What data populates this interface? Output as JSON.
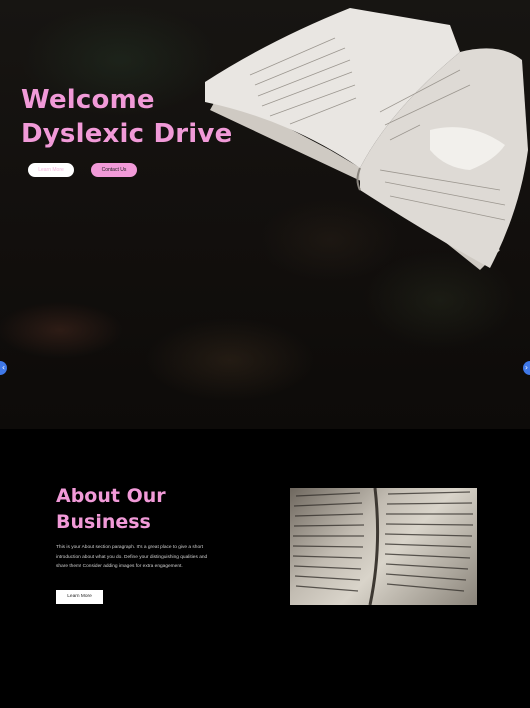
{
  "hero": {
    "title_line1": "Welcome",
    "title_line2": "Dyslexic Drive",
    "learn_more_label": "Learn More",
    "contact_label": "Contact Us",
    "prev_icon": "chevron-left-icon",
    "next_icon": "chevron-right-icon"
  },
  "about": {
    "title_line1": "About Our",
    "title_line2": "Business",
    "paragraph": "This is your About section paragraph. It's a great place to give a short introduction about what you do. Define your distinguishing qualities and share them! Consider adding images for extra engagement.",
    "button_label": "Learn More"
  },
  "colors": {
    "accent_pink": "#f19ad8",
    "background": "#000000",
    "arrow_blue": "#3f78e8"
  }
}
